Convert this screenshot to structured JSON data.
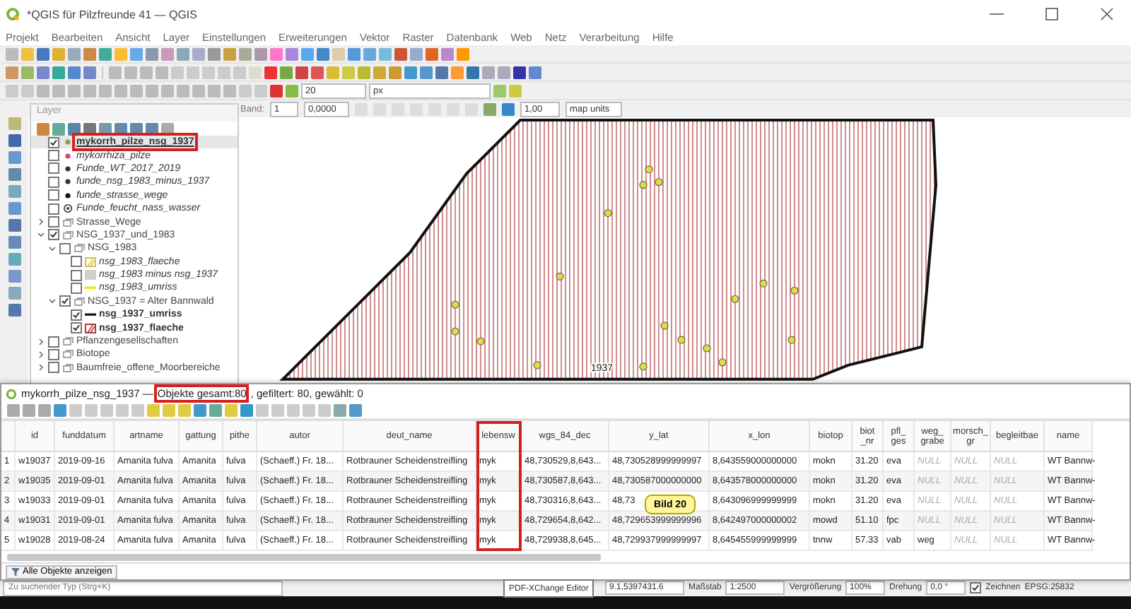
{
  "window": {
    "title": "*QGIS für Pilzfreunde 41 — QGIS"
  },
  "menu": [
    "Projekt",
    "Bearbeiten",
    "Ansicht",
    "Layer",
    "Einstellungen",
    "Erweiterungen",
    "Vektor",
    "Raster",
    "Datenbank",
    "Web",
    "Netz",
    "Verarbeitung",
    "Hilfe"
  ],
  "snapping": {
    "tolerance": "20",
    "unit": "px"
  },
  "raster_toolbar": {
    "band_label": "Band:",
    "band_value": "1",
    "value": "0,0000",
    "scale": "1,00",
    "unit": "map units"
  },
  "layers_panel": {
    "title": "Layer",
    "items": [
      {
        "name": "mykorrh_pilze_nsg_1937",
        "kind": "point",
        "color": "#8a9a5b",
        "checked": true,
        "selected": true,
        "highlighted": true
      },
      {
        "name": "mykorrhiza_pilze",
        "kind": "point",
        "color": "#d0407a",
        "checked": false,
        "selected": false,
        "highlighted": false
      },
      {
        "name": "Funde_WT_2017_2019",
        "kind": "point",
        "color": "#333333",
        "checked": false,
        "selected": false,
        "highlighted": false
      },
      {
        "name": "funde_nsg_1983_minus_1937",
        "kind": "point",
        "color": "#333333",
        "checked": false,
        "selected": false,
        "highlighted": false
      },
      {
        "name": "funde_strasse_wege",
        "kind": "point",
        "color": "#111111",
        "checked": false,
        "selected": false,
        "highlighted": false
      },
      {
        "name": "Funde_feucht_nass_wasser",
        "kind": "ring",
        "color": "#333333",
        "checked": false,
        "selected": false,
        "highlighted": false
      },
      {
        "name": "Strasse_Wege",
        "kind": "group",
        "checked": false,
        "expanded": false,
        "selected": false,
        "highlighted": false
      },
      {
        "name": "NSG_1937_und_1983",
        "kind": "group",
        "checked": true,
        "expanded": true,
        "selected": false,
        "highlighted": false,
        "children": [
          {
            "name": "NSG_1983",
            "kind": "group",
            "checked": false,
            "expanded": true,
            "selected": false,
            "highlighted": false,
            "children": [
              {
                "name": "nsg_1983_flaeche",
                "kind": "hatch",
                "color": "#d8c24a",
                "checked": false,
                "selected": false,
                "highlighted": false
              },
              {
                "name": "nsg_1983 minus nsg_1937",
                "kind": "fill",
                "color": "#cfcfcf",
                "checked": false,
                "selected": false,
                "highlighted": false
              },
              {
                "name": "nsg_1983_umriss",
                "kind": "line",
                "color": "#f2e600",
                "checked": false,
                "selected": false,
                "highlighted": false
              }
            ]
          },
          {
            "name": "NSG_1937 = Alter Bannwald",
            "kind": "group",
            "checked": true,
            "expanded": true,
            "selected": false,
            "highlighted": false,
            "children": [
              {
                "name": "nsg_1937_umriss",
                "kind": "line",
                "color": "#111111",
                "checked": true,
                "selected": false,
                "highlighted": false
              },
              {
                "name": "nsg_1937_flaeche",
                "kind": "hatch",
                "color": "#b03a3a",
                "checked": true,
                "selected": false,
                "highlighted": false
              }
            ]
          }
        ]
      },
      {
        "name": "Pflanzengesellschaften",
        "kind": "group",
        "checked": false,
        "expanded": false,
        "selected": false,
        "highlighted": false
      },
      {
        "name": "Biotope",
        "kind": "group",
        "checked": false,
        "expanded": false,
        "selected": false,
        "highlighted": false
      },
      {
        "name": "Baumfreie_offene_Moorbereiche",
        "kind": "group",
        "checked": false,
        "expanded": false,
        "selected": false,
        "highlighted": false
      }
    ]
  },
  "map": {
    "label": "1937"
  },
  "attribute_table": {
    "title_segments": [
      {
        "text": "mykorrh_pilze_nsg_1937 —",
        "highlighted": false
      },
      {
        "text": "Objekte gesamt:80",
        "highlighted": true
      },
      {
        "text": ", gefiltert: 80, gewählt: 0",
        "highlighted": false
      }
    ],
    "columns": [
      {
        "label": "id",
        "highlighted": false
      },
      {
        "label": "funddatum",
        "highlighted": false
      },
      {
        "label": "artname",
        "highlighted": false
      },
      {
        "label": "gattung",
        "highlighted": false
      },
      {
        "label": "pithe",
        "highlighted": false
      },
      {
        "label": "autor",
        "highlighted": false
      },
      {
        "label": "deut_name",
        "highlighted": false
      },
      {
        "label": "lebensw",
        "highlighted": true
      },
      {
        "label": "wgs_84_dec",
        "highlighted": false
      },
      {
        "label": "y_lat",
        "highlighted": false
      },
      {
        "label": "x_lon",
        "highlighted": false
      },
      {
        "label": "biotop",
        "highlighted": false
      },
      {
        "label": "biot\n_nr",
        "highlighted": false
      },
      {
        "label": "pfl_\nges",
        "highlighted": false
      },
      {
        "label": "weg_\ngrabe",
        "highlighted": false
      },
      {
        "label": "morsch_\ngr",
        "highlighted": false
      },
      {
        "label": "begleitbae",
        "highlighted": false
      },
      {
        "label": "name",
        "highlighted": false
      }
    ],
    "rows": [
      {
        "label": "1",
        "cells": [
          "w19037",
          "2019-09-16",
          "Amanita  fulva",
          "Amanita",
          "fulva",
          "(Schaeff.) Fr. 18...",
          "Rotbrauner Scheidenstreifling",
          "myk",
          "48,730529,8,643...",
          "48,730528999999997",
          "8,643559000000000",
          "mokn",
          "31.20",
          "eva",
          {
            "text": "NULL",
            "kind": "null"
          },
          {
            "text": "NULL",
            "kind": "null"
          },
          {
            "text": "NULL",
            "kind": "null"
          },
          "WT Bannw-"
        ]
      },
      {
        "label": "2",
        "cells": [
          "w19035",
          "2019-09-01",
          "Amanita  fulva",
          "Amanita",
          "fulva",
          "(Schaeff.) Fr. 18...",
          "Rotbrauner Scheidenstreifling",
          "myk",
          "48,730587,8,643...",
          "48,730587000000000",
          "8,643578000000000",
          "mokn",
          "31.20",
          "eva",
          {
            "text": "NULL",
            "kind": "null"
          },
          {
            "text": "NULL",
            "kind": "null"
          },
          {
            "text": "NULL",
            "kind": "null"
          },
          "WT Bannw-"
        ]
      },
      {
        "label": "3",
        "cells": [
          "w19033",
          "2019-09-01",
          "Amanita  fulva",
          "Amanita",
          "fulva",
          "(Schaeff.) Fr. 18...",
          "Rotbrauner Scheidenstreifling",
          "myk",
          "48,730316,8,643...",
          "48,73",
          "8,643096999999999",
          "mokn",
          "31.20",
          "eva",
          {
            "text": "NULL",
            "kind": "null"
          },
          {
            "text": "NULL",
            "kind": "null"
          },
          {
            "text": "NULL",
            "kind": "null"
          },
          "WT Bannw-"
        ]
      },
      {
        "label": "4",
        "cells": [
          "w19031",
          "2019-09-01",
          "Amanita  fulva",
          "Amanita",
          "fulva",
          "(Schaeff.) Fr. 18...",
          "Rotbrauner Scheidenstreifling",
          "myk",
          "48,729654,8,642...",
          "48,729653999999996",
          "8,642497000000002",
          "mowd",
          "51.10",
          "fpc",
          {
            "text": "NULL",
            "kind": "null"
          },
          {
            "text": "NULL",
            "kind": "null"
          },
          {
            "text": "NULL",
            "kind": "null"
          },
          "WT Bannw-"
        ]
      },
      {
        "label": "5",
        "cells": [
          "w19028",
          "2019-08-24",
          "Amanita  fulva",
          "Amanita",
          "fulva",
          "(Schaeff.) Fr. 18...",
          "Rotbrauner Scheidenstreifling",
          "myk",
          "48,729938,8,645...",
          "48,729937999999997",
          "8,645455999999999",
          "tnnw",
          "57.33",
          "vab",
          "weg",
          {
            "text": "NULL",
            "kind": "null"
          },
          {
            "text": "NULL",
            "kind": "null"
          },
          "WT Bannw-"
        ]
      }
    ],
    "tooltip": "Bild 20",
    "show_all_button": "Alle Objekte anzeigen"
  },
  "status_bar": {
    "search_placeholder": "Zu suchender Typ (Strg+K)",
    "coordinate": "9.1,5397431.6",
    "scale_label": "Maßstab",
    "scale": "1:2500",
    "magnifier_label": "Vergrößerung",
    "magnifier": "100%",
    "rotation_label": "Drehung",
    "rotation": "0,0 °",
    "render_label": "Zeichnen",
    "render_checked": true,
    "crs": "EPSG:25832"
  },
  "taskbar_tooltip": "PDF-XChange Editor"
}
